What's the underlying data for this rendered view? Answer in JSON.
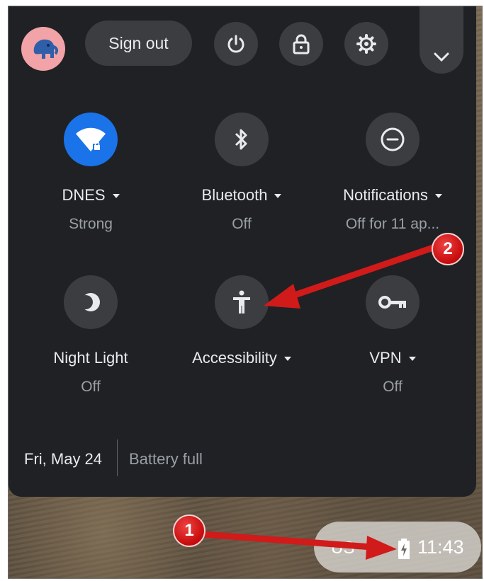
{
  "header": {
    "sign_out_label": "Sign out",
    "buttons": [
      "power-icon",
      "lock-icon",
      "gear-icon",
      "chevron-down-icon"
    ]
  },
  "tiles": [
    {
      "label": "DNES",
      "sublabel": "Strong",
      "icon": "wifi-locked-icon",
      "active": true
    },
    {
      "label": "Bluetooth",
      "sublabel": "Off",
      "icon": "bluetooth-icon",
      "active": false
    },
    {
      "label": "Notifications",
      "sublabel": "Off for 11 ap...",
      "icon": "do-not-disturb-icon",
      "active": false
    },
    {
      "label": "Night Light",
      "sublabel": "Off",
      "icon": "night-light-icon",
      "active": false
    },
    {
      "label": "Accessibility",
      "sublabel": "",
      "icon": "accessibility-icon",
      "active": false
    },
    {
      "label": "VPN",
      "sublabel": "Off",
      "icon": "vpn-key-icon",
      "active": false
    }
  ],
  "footer": {
    "date": "Fri, May 24",
    "battery": "Battery full"
  },
  "tray": {
    "ime": "US",
    "time": "11:43"
  },
  "annotations": [
    {
      "number": "1"
    },
    {
      "number": "2"
    }
  ],
  "colors": {
    "panel": "#202124",
    "button": "#3c3d40",
    "accent": "#1a73e8",
    "annotation": "#d11a1a"
  }
}
